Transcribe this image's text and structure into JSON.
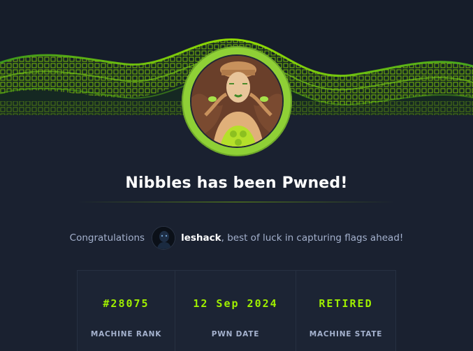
{
  "banner": {
    "accent": "#9fef00"
  },
  "machine": {
    "avatar_icon": "nibbles-machine-avatar",
    "title": "Nibbles has been Pwned!"
  },
  "congrats": {
    "lead": "Congratulations",
    "user_avatar_icon": "user-avatar",
    "username": "leshack",
    "tail": ", best of luck in capturing flags ahead!"
  },
  "stats": [
    {
      "value": "#28075",
      "label": "MACHINE RANK"
    },
    {
      "value": "12 Sep 2024",
      "label": "PWN DATE"
    },
    {
      "value": "RETIRED",
      "label": "MACHINE STATE"
    }
  ],
  "colors": {
    "background": "#1a2130",
    "accent": "#9fef00",
    "muted_text": "#a4b1cd"
  }
}
